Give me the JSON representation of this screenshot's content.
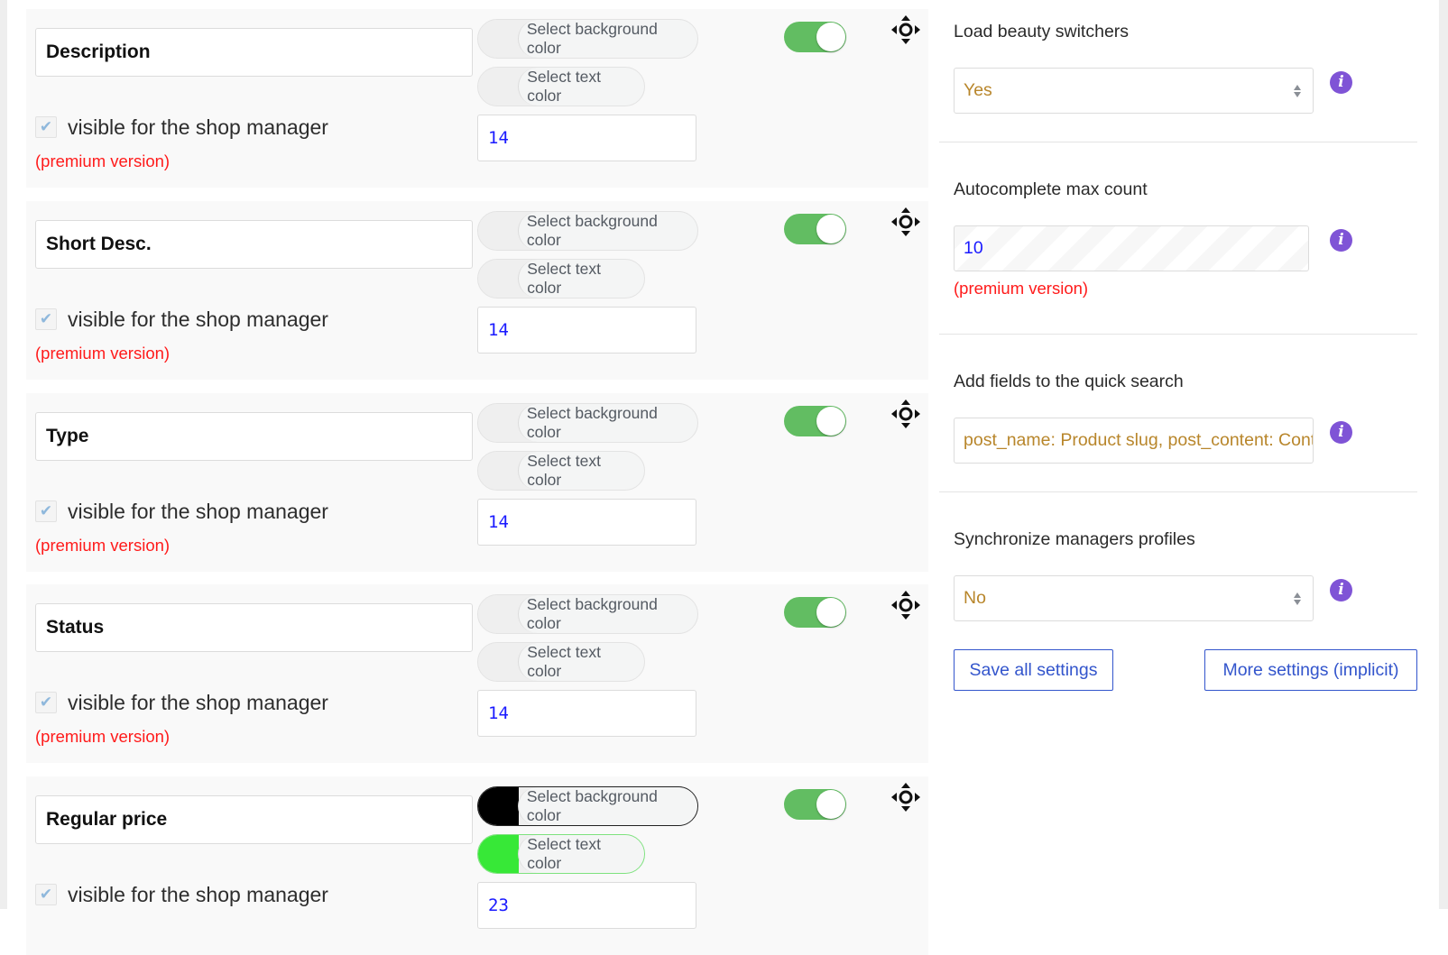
{
  "fields": [
    {
      "title": "Description",
      "visible_label": "visible for the shop manager",
      "visible_checked": true,
      "premium_note": "(premium version)",
      "bg_color_label": "Select background color",
      "bg_color": "#efefef",
      "text_color_label": "Select text color",
      "text_color": "#efefef",
      "size": "14",
      "enabled": true
    },
    {
      "title": "Short Desc.",
      "visible_label": "visible for the shop manager",
      "visible_checked": true,
      "premium_note": "(premium version)",
      "bg_color_label": "Select background color",
      "bg_color": "#efefef",
      "text_color_label": "Select text color",
      "text_color": "#efefef",
      "size": "14",
      "enabled": true
    },
    {
      "title": "Type",
      "visible_label": "visible for the shop manager",
      "visible_checked": true,
      "premium_note": "(premium version)",
      "bg_color_label": "Select background color",
      "bg_color": "#efefef",
      "text_color_label": "Select text color",
      "text_color": "#efefef",
      "size": "14",
      "enabled": true
    },
    {
      "title": "Status",
      "visible_label": "visible for the shop manager",
      "visible_checked": true,
      "premium_note": "(premium version)",
      "bg_color_label": "Select background color",
      "bg_color": "#efefef",
      "text_color_label": "Select text color",
      "text_color": "#efefef",
      "size": "14",
      "enabled": true
    },
    {
      "title": "Regular price",
      "visible_label": "visible for the shop manager",
      "visible_checked": true,
      "premium_note": "",
      "bg_color_label": "Select background color",
      "bg_color": "#000000",
      "text_color_label": "Select text color",
      "text_color": "#37e837",
      "size": "23",
      "enabled": true
    }
  ],
  "settings": {
    "load_beauty": {
      "title": "Load beauty switchers",
      "value": "Yes"
    },
    "autocomplete": {
      "title": "Autocomplete max count",
      "value": "10",
      "premium_note": "(premium version)"
    },
    "quick_search": {
      "title": "Add fields to the quick search",
      "value": "post_name: Product slug, post_content: Content"
    },
    "sync_profiles": {
      "title": "Synchronize managers profiles",
      "value": "No"
    },
    "info_icon": "i"
  },
  "buttons": {
    "save": "Save all settings",
    "more": "More settings (implicit)"
  },
  "colors": {
    "toggle_on": "#62bd62",
    "info": "#7f54d6",
    "premium": "#ff1a1a",
    "button_accent": "#3355cc"
  }
}
